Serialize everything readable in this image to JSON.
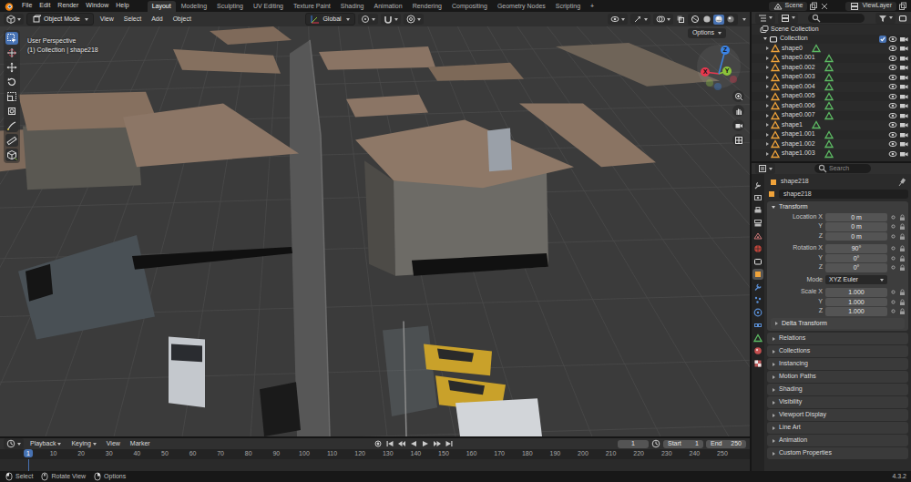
{
  "topbar": {
    "menus": [
      "File",
      "Edit",
      "Render",
      "Window",
      "Help"
    ],
    "workspaces": [
      {
        "label": "Layout",
        "selected": true
      },
      {
        "label": "Modeling",
        "selected": false
      },
      {
        "label": "Sculpting",
        "selected": false
      },
      {
        "label": "UV Editing",
        "selected": false
      },
      {
        "label": "Texture Paint",
        "selected": false
      },
      {
        "label": "Shading",
        "selected": false
      },
      {
        "label": "Animation",
        "selected": false
      },
      {
        "label": "Rendering",
        "selected": false
      },
      {
        "label": "Compositing",
        "selected": false
      },
      {
        "label": "Geometry Nodes",
        "selected": false
      },
      {
        "label": "Scripting",
        "selected": false
      }
    ],
    "add_workspace": "+",
    "scene": "Scene",
    "view_layer": "ViewLayer"
  },
  "viewport": {
    "mode": "Object Mode",
    "menus": [
      "View",
      "Select",
      "Add",
      "Object"
    ],
    "orientation": "Global",
    "view_name": "User Perspective",
    "context": "(1) Collection | shape218",
    "options": "Options",
    "axes": [
      {
        "label": "X",
        "color": "#e5384f"
      },
      {
        "label": "Y",
        "color": "#8bc43b"
      },
      {
        "label": "Z",
        "color": "#3b83e3"
      }
    ],
    "tools": [
      {
        "selected": true
      },
      {
        "selected": false
      },
      {
        "selected": false
      },
      {
        "selected": false
      },
      {
        "selected": false
      },
      {
        "selected": false
      },
      {
        "selected": false
      },
      {
        "selected": false
      },
      {
        "selected": false
      }
    ],
    "shading": [
      {
        "selected": false
      },
      {
        "selected": false
      },
      {
        "selected": true
      },
      {
        "selected": false
      }
    ]
  },
  "outliner": {
    "root": "Scene Collection",
    "collection": {
      "name": "Collection",
      "checked": true,
      "visible": true
    },
    "items": [
      {
        "name": "shape0",
        "visible": true
      },
      {
        "name": "shape0.001",
        "visible": true
      },
      {
        "name": "shape0.002",
        "visible": true
      },
      {
        "name": "shape0.003",
        "visible": true
      },
      {
        "name": "shape0.004",
        "visible": true
      },
      {
        "name": "shape0.005",
        "visible": true
      },
      {
        "name": "shape0.006",
        "visible": true
      },
      {
        "name": "shape0.007",
        "visible": true
      },
      {
        "name": "shape1",
        "visible": true
      },
      {
        "name": "shape1.001",
        "visible": true
      },
      {
        "name": "shape1.002",
        "visible": true
      },
      {
        "name": "shape1.003",
        "visible": true
      }
    ]
  },
  "properties": {
    "search_placeholder": "Search",
    "tabs": [
      {
        "selected": false
      },
      {
        "selected": false
      },
      {
        "selected": false
      },
      {
        "selected": false
      },
      {
        "selected": false
      },
      {
        "selected": false
      },
      {
        "selected": false
      },
      {
        "selected": true
      },
      {
        "selected": false
      },
      {
        "selected": false
      },
      {
        "selected": false
      },
      {
        "selected": false
      },
      {
        "selected": false
      },
      {
        "selected": false
      },
      {
        "selected": false
      }
    ],
    "breadcrumb": "shape218",
    "object_name": "shape218",
    "transform": {
      "title": "Transform",
      "expanded": true,
      "location": [
        {
          "label": "Location X",
          "value": "0 m"
        },
        {
          "label": "Y",
          "value": "0 m"
        },
        {
          "label": "Z",
          "value": "0 m"
        }
      ],
      "rotation": [
        {
          "label": "Rotation X",
          "value": "90°"
        },
        {
          "label": "Y",
          "value": "0°"
        },
        {
          "label": "Z",
          "value": "0°"
        }
      ],
      "mode_label": "Mode",
      "mode": "XYZ Euler",
      "scale": [
        {
          "label": "Scale X",
          "value": "1.000"
        },
        {
          "label": "Y",
          "value": "1.000"
        },
        {
          "label": "Z",
          "value": "1.000"
        }
      ],
      "delta": {
        "title": "Delta Transform",
        "expanded": false
      }
    },
    "panels": [
      {
        "title": "Relations",
        "expanded": false
      },
      {
        "title": "Collections",
        "expanded": false
      },
      {
        "title": "Instancing",
        "expanded": false
      },
      {
        "title": "Motion Paths",
        "expanded": false
      },
      {
        "title": "Shading",
        "expanded": false
      },
      {
        "title": "Visibility",
        "expanded": false
      },
      {
        "title": "Viewport Display",
        "expanded": false
      },
      {
        "title": "Line Art",
        "expanded": false
      },
      {
        "title": "Animation",
        "expanded": false
      },
      {
        "title": "Custom Properties",
        "expanded": false
      }
    ]
  },
  "timeline": {
    "menus": [
      {
        "label": "Playback",
        "kind": "popover"
      },
      {
        "label": "Keying",
        "kind": "popover"
      },
      {
        "label": "View",
        "kind": "menu"
      },
      {
        "label": "Marker",
        "kind": "menu"
      }
    ],
    "current_frame": "1",
    "start_label": "Start",
    "start": "1",
    "end_label": "End",
    "end": "250",
    "ticks": [
      "10",
      "20",
      "30",
      "40",
      "50",
      "60",
      "70",
      "80",
      "90",
      "100",
      "110",
      "120",
      "130",
      "140",
      "150",
      "160",
      "170",
      "180",
      "190",
      "200",
      "210",
      "220",
      "230",
      "240",
      "250"
    ],
    "playhead": "1"
  },
  "status_bar": {
    "items": [
      "Select",
      "Rotate View",
      "Options"
    ],
    "version": "4.3.2"
  }
}
